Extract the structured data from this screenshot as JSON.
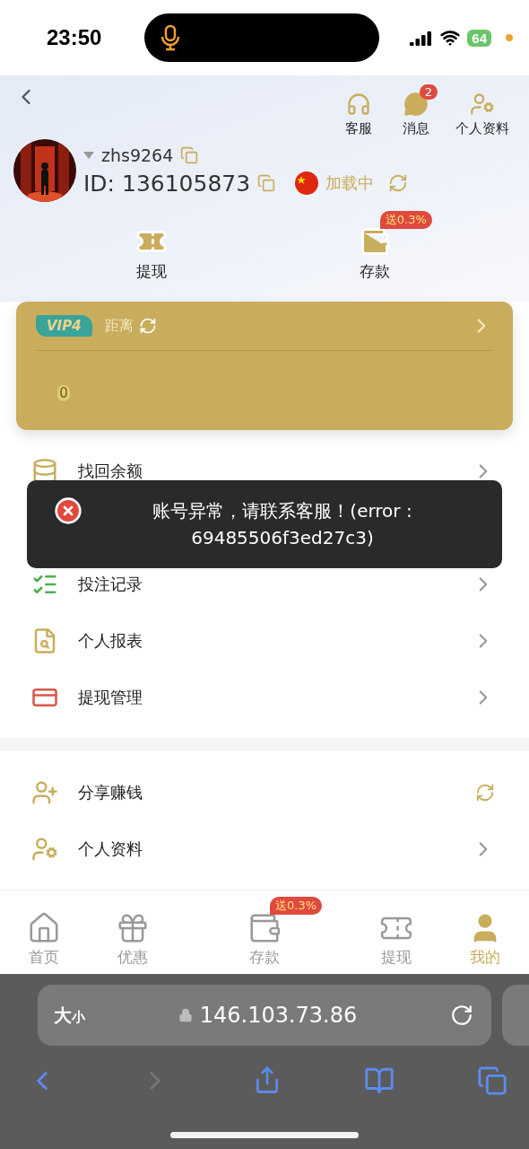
{
  "status_bar": {
    "time": "23:50",
    "battery": "64"
  },
  "header": {
    "top_actions": [
      {
        "label": "客服"
      },
      {
        "label": "消息",
        "badge": "2"
      },
      {
        "label": "个人资料"
      }
    ],
    "profile": {
      "username": "zhs9264",
      "id": "ID: 136105873",
      "region_status": "加载中"
    },
    "quick_actions": [
      {
        "label": "提现"
      },
      {
        "label": "存款",
        "badge": "送0.3%"
      }
    ]
  },
  "vip_card": {
    "vip_badge": "VIP4",
    "distance_label": "距离",
    "amount": "0"
  },
  "menu_sections": [
    {
      "items": [
        {
          "label": "找回余额",
          "kind": "link"
        },
        {
          "kind": "covered"
        },
        {
          "label": "投注记录",
          "kind": "link"
        },
        {
          "label": "个人报表",
          "kind": "link"
        },
        {
          "label": "提现管理",
          "kind": "link"
        }
      ]
    },
    {
      "items": [
        {
          "label": "分享赚钱",
          "kind": "loading"
        },
        {
          "label": "个人资料",
          "kind": "link"
        }
      ]
    }
  ],
  "toast": {
    "message": "账号异常，请联系客服！(error : 69485506f3ed27c3)"
  },
  "tab_bar": [
    {
      "label": "首页",
      "selected": false
    },
    {
      "label": "优惠",
      "selected": false
    },
    {
      "label": "存款",
      "selected": false,
      "badge": "送0.3%"
    },
    {
      "label": "提现",
      "selected": false
    },
    {
      "label": "我的",
      "selected": true
    }
  ],
  "browser": {
    "size_large": "大",
    "size_small": "小",
    "address": "146.103.73.86"
  }
}
